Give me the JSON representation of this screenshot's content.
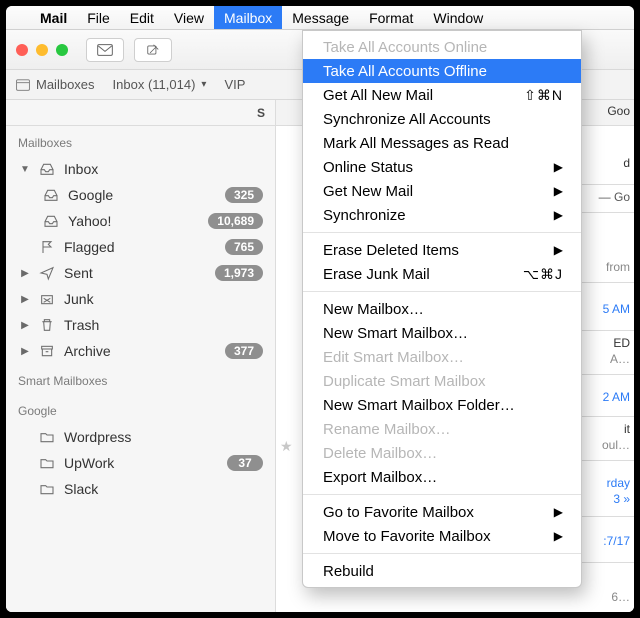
{
  "menubar": {
    "app": "Mail",
    "items": [
      "File",
      "Edit",
      "View",
      "Mailbox",
      "Message",
      "Format",
      "Window"
    ],
    "open_index": 3
  },
  "toolbar": {
    "compose_icon": "envelope",
    "new_icon": "compose"
  },
  "tabstrip": {
    "mailboxes": "Mailboxes",
    "inbox_label": "Inbox (11,014)",
    "vips": "VIP"
  },
  "sidebar": {
    "sort_label": "S",
    "sections": {
      "mailboxes": "Mailboxes",
      "smart": "Smart Mailboxes",
      "google": "Google"
    },
    "items": [
      {
        "name": "Inbox",
        "tri": "down",
        "icon": "inbox",
        "badge": ""
      },
      {
        "name": "Google",
        "child": true,
        "icon": "inbox",
        "badge": "325"
      },
      {
        "name": "Yahoo!",
        "child": true,
        "icon": "inbox",
        "badge": "10,689"
      },
      {
        "name": "Flagged",
        "tri": "",
        "icon": "flag",
        "badge": "765"
      },
      {
        "name": "Sent",
        "tri": "right",
        "icon": "sent",
        "badge": "1,973"
      },
      {
        "name": "Junk",
        "tri": "right",
        "icon": "junk",
        "badge": ""
      },
      {
        "name": "Trash",
        "tri": "right",
        "icon": "trash",
        "badge": ""
      },
      {
        "name": "Archive",
        "tri": "right",
        "icon": "archive",
        "badge": "377"
      }
    ],
    "google_items": [
      {
        "name": "Wordpress",
        "badge": ""
      },
      {
        "name": "UpWork",
        "badge": "37"
      },
      {
        "name": "Slack",
        "badge": ""
      }
    ]
  },
  "dropdown": {
    "items": [
      {
        "label": "Take All Accounts Online",
        "state": "disabled"
      },
      {
        "label": "Take All Accounts Offline",
        "state": "highlight"
      },
      {
        "label": "Get All New Mail",
        "shortcut": "⇧⌘N"
      },
      {
        "label": "Synchronize All Accounts"
      },
      {
        "label": "Mark All Messages as Read"
      },
      {
        "label": "Online Status",
        "submenu": true
      },
      {
        "label": "Get New Mail",
        "submenu": true
      },
      {
        "label": "Synchronize",
        "submenu": true
      },
      {
        "sep": true
      },
      {
        "label": "Erase Deleted Items",
        "submenu": true
      },
      {
        "label": "Erase Junk Mail",
        "shortcut": "⌥⌘J"
      },
      {
        "sep": true
      },
      {
        "label": "New Mailbox…"
      },
      {
        "label": "New Smart Mailbox…"
      },
      {
        "label": "Edit Smart Mailbox…",
        "state": "disabled"
      },
      {
        "label": "Duplicate Smart Mailbox",
        "state": "disabled"
      },
      {
        "label": "New Smart Mailbox Folder…"
      },
      {
        "label": "Rename Mailbox…",
        "state": "disabled"
      },
      {
        "label": "Delete Mailbox…",
        "state": "disabled"
      },
      {
        "label": "Export Mailbox…"
      },
      {
        "sep": true
      },
      {
        "label": "Go to Favorite Mailbox",
        "submenu": true
      },
      {
        "label": "Move to Favorite Mailbox",
        "submenu": true
      },
      {
        "sep": true
      },
      {
        "label": "Rebuild"
      }
    ]
  },
  "list_fragments": {
    "r0": "Goo",
    "r1": "d",
    "r2": "— Go",
    "r3": "from",
    "r4": "5 AM",
    "r5": "ED",
    "r6": "A…",
    "r7": "2 AM",
    "r8": "it",
    "r9": "oul…",
    "r10": "rday",
    "r11": "3 »",
    "r12": ":7/17",
    "r13": "6…"
  }
}
